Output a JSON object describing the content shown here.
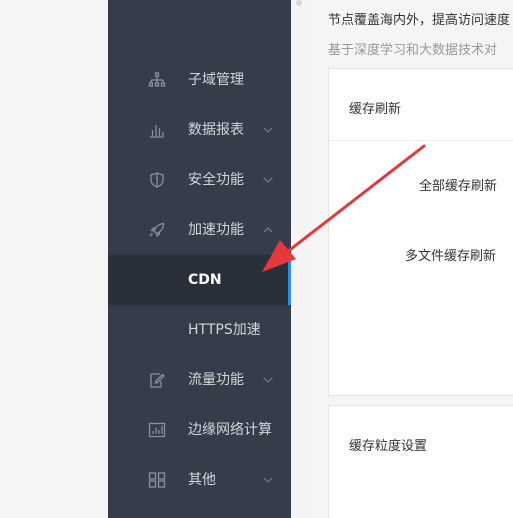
{
  "sidebar": {
    "items": [
      {
        "label": "子域管理",
        "icon": "sitemap-icon",
        "chevron": false
      },
      {
        "label": "数据报表",
        "icon": "bar-chart-icon",
        "chevron": "down"
      },
      {
        "label": "安全功能",
        "icon": "shield-icon",
        "chevron": "down"
      },
      {
        "label": "加速功能",
        "icon": "rocket-icon",
        "chevron": "up"
      },
      {
        "label": "CDN",
        "icon": "",
        "chevron": false,
        "active": true
      },
      {
        "label": "HTTPS加速",
        "icon": "",
        "chevron": false
      },
      {
        "label": "流量功能",
        "icon": "edit-icon",
        "chevron": "down"
      },
      {
        "label": "边缘网络计算",
        "icon": "chart-box-icon",
        "chevron": false
      },
      {
        "label": "其他",
        "icon": "grid-icon",
        "chevron": "down"
      }
    ]
  },
  "main": {
    "intro_line1": "节点覆盖海内外，提高访问速度",
    "intro_line2": "基于深度学习和大数据技术对",
    "cache_refresh": {
      "title": "缓存刷新",
      "full_refresh_label": "全部缓存刷新",
      "multi_file_refresh_label": "多文件缓存刷新"
    },
    "cache_granularity": {
      "title": "缓存粒度设置"
    }
  },
  "colors": {
    "sidebar_bg": "#353d4a",
    "sidebar_active_bg": "#293039",
    "active_indicator": "#2f8be6",
    "annotation_arrow": "#e8373b"
  }
}
